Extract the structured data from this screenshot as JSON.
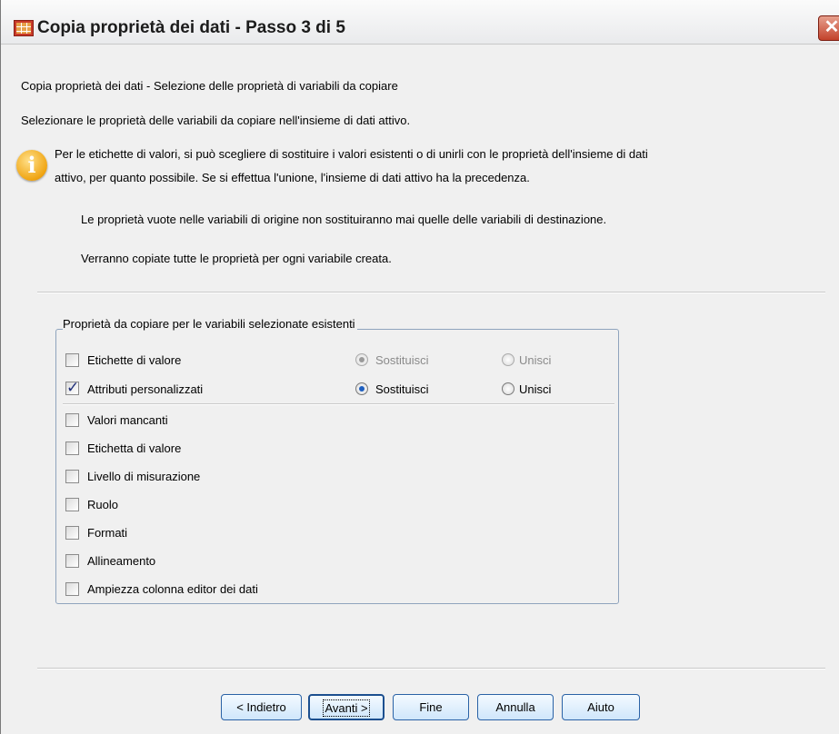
{
  "window": {
    "title": "Copia proprietà dei dati - Passo 3 di 5",
    "close_label": "✕"
  },
  "header": {
    "heading": "Copia proprietà dei dati - Selezione delle proprietà di variabili da copiare",
    "instruction": "Selezionare le proprietà delle variabili da copiare nell'insieme di dati attivo.",
    "info_line1": "Per le etichette di valori, si può scegliere di sostituire i valori esistenti o di unirli con le proprietà dell'insieme di dati",
    "info_line2": "attivo, per quanto possibile.   Se si effettua l'unione, l'insieme di dati attivo ha la precedenza.",
    "note1": "Le proprietà vuote nelle variabili di origine non sostituiranno mai quelle delle variabili di destinazione.",
    "note2": "Verranno copiate tutte le proprietà per ogni variabile creata."
  },
  "group": {
    "title": "Proprietà da copiare per le variabili selezionate esistenti",
    "value_labels": {
      "label": "Etichette di valore",
      "checked": false,
      "replace": "Sostituisci",
      "merge": "Unisci",
      "mode": "replace",
      "enabled": false
    },
    "custom_attributes": {
      "label": "Attributi personalizzati",
      "checked": true,
      "replace": "Sostituisci",
      "merge": "Unisci",
      "mode": "replace",
      "enabled": true
    },
    "items": [
      {
        "label": "Valori mancanti",
        "checked": false
      },
      {
        "label": "Etichetta di valore",
        "checked": false
      },
      {
        "label": "Livello di misurazione",
        "checked": false
      },
      {
        "label": "Ruolo",
        "checked": false
      },
      {
        "label": "Formati",
        "checked": false
      },
      {
        "label": "Allineamento",
        "checked": false
      },
      {
        "label": "Ampiezza colonna editor dei dati",
        "checked": false
      }
    ]
  },
  "buttons": {
    "back": "< Indietro",
    "next": "Avanti >",
    "finish": "Fine",
    "cancel": "Annulla",
    "help": "Aiuto"
  }
}
